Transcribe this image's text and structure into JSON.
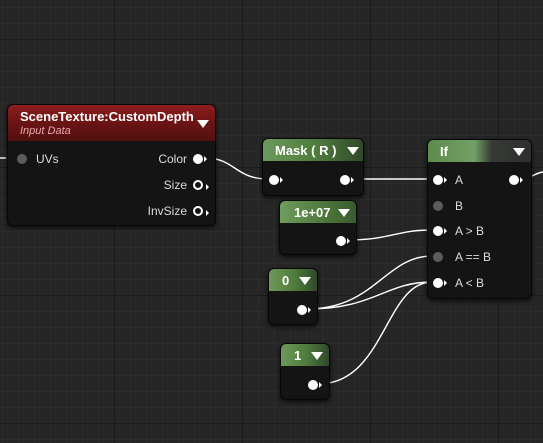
{
  "nodes": {
    "scene_texture": {
      "title": "SceneTexture:CustomDepth",
      "subtitle": "Input Data",
      "inputs": [
        {
          "label": "UVs"
        }
      ],
      "outputs": [
        {
          "label": "Color"
        },
        {
          "label": "Size"
        },
        {
          "label": "InvSize"
        }
      ]
    },
    "mask": {
      "title": "Mask ( R )"
    },
    "constant_big": {
      "title": "1e+07"
    },
    "constant_zero": {
      "title": "0"
    },
    "constant_one": {
      "title": "1"
    },
    "if_node": {
      "title": "If",
      "inputs": [
        {
          "label": "A"
        },
        {
          "label": "B"
        },
        {
          "label": "A > B"
        },
        {
          "label": "A == B"
        },
        {
          "label": "A < B"
        }
      ]
    }
  },
  "icons": {
    "collapse": "chevron-down-icon",
    "exec_pin": "circle-pin-icon"
  },
  "colors": {
    "graph_background": "#262626",
    "material_header": "#8e1e1e",
    "constant_header": "#6d9a5b",
    "wire": "#ffffff"
  }
}
